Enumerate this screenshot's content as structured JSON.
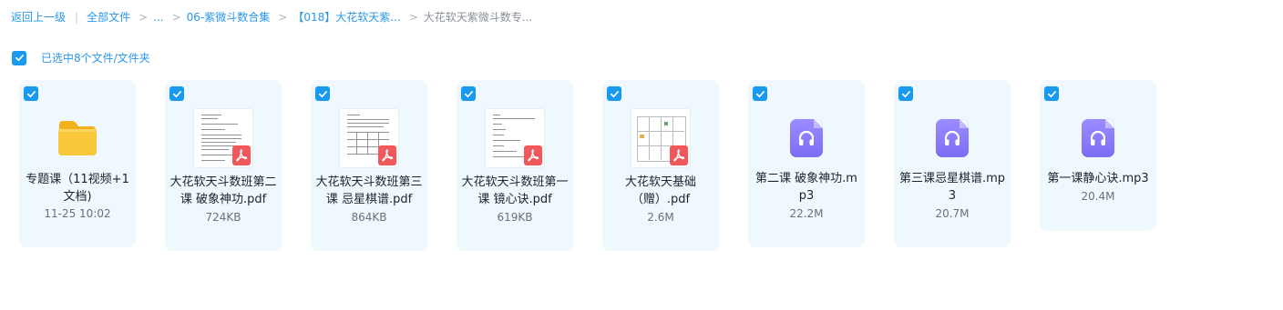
{
  "breadcrumb": {
    "back": "返回上一级",
    "all_files": "全部文件",
    "ellipsis": "...",
    "folder_1": "06-紫微斗数合集",
    "folder_2": "【018】大花软天紫...",
    "current": "大花软天紫微斗数专..."
  },
  "selection": {
    "label": "已选中8个文件/文件夹",
    "color": "#1a9aee"
  },
  "files": [
    {
      "name": "专题课（11视频+1文档)",
      "meta": "11-25 10:02",
      "type": "folder",
      "icon": "folder-icon"
    },
    {
      "name": "大花软天斗数班第二课 破象神功.pdf",
      "meta": "724KB",
      "type": "pdf",
      "icon": "pdf-icon"
    },
    {
      "name": "大花软天斗数班第三课 忌星棋谱.pdf",
      "meta": "864KB",
      "type": "pdf",
      "icon": "pdf-icon"
    },
    {
      "name": "大花软天斗数班第一课 镜心诀.pdf",
      "meta": "619KB",
      "type": "pdf",
      "icon": "pdf-icon"
    },
    {
      "name": "大花软天基础（赠）.pdf",
      "meta": "2.6M",
      "type": "pdf",
      "icon": "pdf-icon"
    },
    {
      "name": "第二课 破象神功.mp3",
      "meta": "22.2M",
      "type": "audio",
      "icon": "headphones-icon"
    },
    {
      "name": "第三课忌星棋谱.mp3",
      "meta": "20.7M",
      "type": "audio",
      "icon": "headphones-icon"
    },
    {
      "name": "第一课静心诀.mp3",
      "meta": "20.4M",
      "type": "audio",
      "icon": "headphones-icon"
    }
  ],
  "colors": {
    "accent": "#2a97e8",
    "card_bg": "#eef8fd",
    "pdf_badge": "#f0585c",
    "audio": "#8a7bfb",
    "folder": "#f7c22e"
  }
}
